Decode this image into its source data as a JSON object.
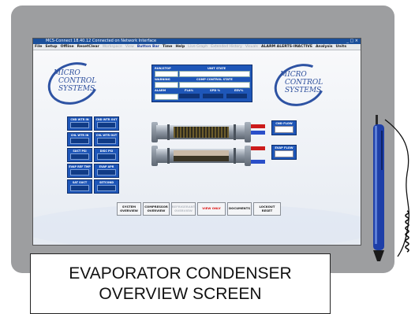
{
  "window": {
    "title": "MCS-Connect 18.40.12 Connected on Network Interface",
    "controls": "_ □ ×"
  },
  "menu": [
    {
      "label": "File",
      "state": "normal"
    },
    {
      "label": "Setup",
      "state": "normal"
    },
    {
      "label": "Offline",
      "state": "normal"
    },
    {
      "label": "ResetClear",
      "state": "normal"
    },
    {
      "label": "Workspace",
      "state": "dim"
    },
    {
      "label": "View",
      "state": "dim"
    },
    {
      "label": "Button Bar",
      "state": "hl"
    },
    {
      "label": "Time",
      "state": "normal"
    },
    {
      "label": "Help",
      "state": "normal"
    },
    {
      "label": "Live Graph",
      "state": "dim"
    },
    {
      "label": "Extended History",
      "state": "dim"
    },
    {
      "label": "Visuals",
      "state": "dim"
    },
    {
      "label": "ALARM ALERTS-INACTIVE",
      "state": "alert"
    },
    {
      "label": "Analysis",
      "state": "normal"
    },
    {
      "label": "Units",
      "state": "normal"
    }
  ],
  "logo": {
    "line1": "MICRO",
    "line2": "CONTROL",
    "line3": "SYSTEMS"
  },
  "status_panel": {
    "run_stop": "RUN/STOP",
    "unit_state": "UNIT STATE",
    "warning": "WARNING",
    "comp_control_state": "COMP CONTROL STATE",
    "alarm": "ALARM",
    "fla": "FLA%",
    "spd": "SPD %",
    "eev": "EEV%"
  },
  "temp_buttons": [
    "CND WTR IN",
    "CND WTR OUT",
    "CHL WTR IN",
    "CHL WTR OUT",
    "SUCT PSI",
    "DISC PSI",
    "EVAP REF TMP",
    "EVAP APR",
    "SAT SUCT",
    "SETCOND"
  ],
  "flow": {
    "condenser": "CND FLOW",
    "evaporator": "EVAP FLOW"
  },
  "nav_buttons": [
    {
      "label": "SYSTEM\nOVERVIEW",
      "state": "normal"
    },
    {
      "label": "COMPRESSOR\nOVERVIEW",
      "state": "normal"
    },
    {
      "label": "REFRIGERANT\nOVERVIEW",
      "state": "dim"
    },
    {
      "label": "VIEW ONLY",
      "state": "red"
    },
    {
      "label": "DOCUMENTS",
      "state": "normal"
    },
    {
      "label": "LOCKOUT\nRESET",
      "state": "normal"
    }
  ],
  "caption": {
    "line1": "EVAPORATOR CONDENSER",
    "line2": "OVERVIEW SCREEN"
  },
  "colors": {
    "panel_blue": "#1e56b8",
    "logo_blue": "#2c4e9c",
    "bezel": "#9d9ea0",
    "alert_red": "#d11111"
  }
}
